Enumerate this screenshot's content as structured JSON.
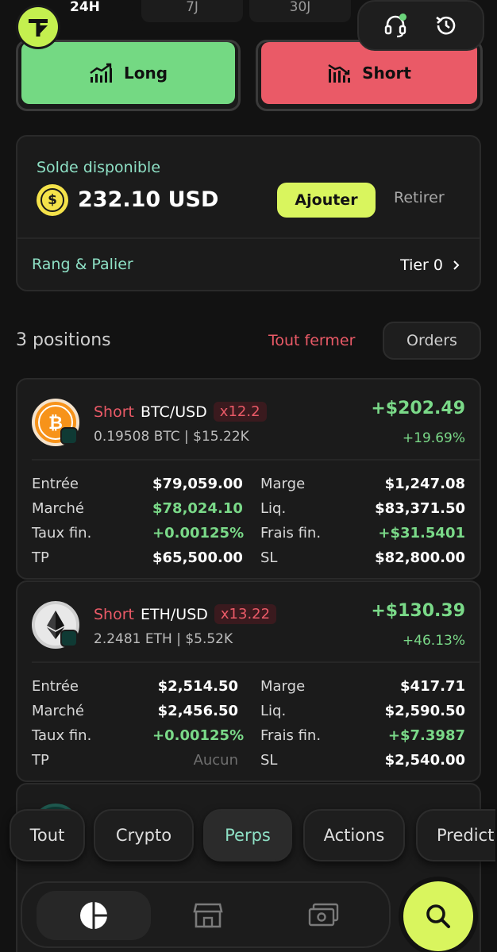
{
  "timeframes": [
    "24H",
    "7J",
    "30J"
  ],
  "trade": {
    "long_label": "Long",
    "short_label": "Short"
  },
  "balance": {
    "label": "Solde disponible",
    "currency_symbol": "$",
    "amount": "232.10 USD",
    "add_label": "Ajouter",
    "withdraw_label": "Retirer",
    "rank_label": "Rang & Palier",
    "tier": "Tier 0"
  },
  "positions_header": {
    "count": "3 positions",
    "close_all": "Tout fermer",
    "orders": "Orders"
  },
  "positions": [
    {
      "side": "Short",
      "pair": "BTC/USD",
      "leverage": "x12.2",
      "size": "0.19508 BTC | $15.22K",
      "pnl": "+$202.49",
      "pnl_pct": "+19.69%",
      "icon": "bitcoin-icon",
      "rows": [
        {
          "l1": "Entrée",
          "v1": "$79,059.00",
          "l2": "Marge",
          "v2": "$1,247.08"
        },
        {
          "l1": "Marché",
          "v1": "$78,024.10",
          "l2": "Liq.",
          "v2": "$83,371.50"
        },
        {
          "l1": "Taux fin.",
          "v1": "+0.00125%",
          "l2": "Frais fin.",
          "v2": "+$31.5401"
        },
        {
          "l1": "TP",
          "v1": "$65,500.00",
          "l2": "SL",
          "v2": "$82,800.00"
        }
      ]
    },
    {
      "side": "Short",
      "pair": "ETH/USD",
      "leverage": "x13.22",
      "size": "2.2481 ETH | $5.52K",
      "pnl": "+$130.39",
      "pnl_pct": "+46.13%",
      "icon": "ethereum-icon",
      "rows": [
        {
          "l1": "Entrée",
          "v1": "$2,514.50",
          "l2": "Marge",
          "v2": "$417.71"
        },
        {
          "l1": "Marché",
          "v1": "$2,456.50",
          "l2": "Liq.",
          "v2": "$2,590.50"
        },
        {
          "l1": "Taux fin.",
          "v1": "+0.00125%",
          "l2": "Frais fin.",
          "v2": "+$7.3987"
        },
        {
          "l1": "TP",
          "v1": "Aucun",
          "l2": "SL",
          "v2": "$2,540.00"
        }
      ]
    }
  ],
  "filters": [
    "Tout",
    "Crypto",
    "Perps",
    "Actions",
    "Predict"
  ],
  "active_filter": "Perps",
  "colors": {
    "long": "#74d983",
    "short": "#ea5a67",
    "accent": "#d9f55e",
    "teal_label": "#8ee0c5",
    "positive": "#7ad988",
    "background": "#121212"
  }
}
